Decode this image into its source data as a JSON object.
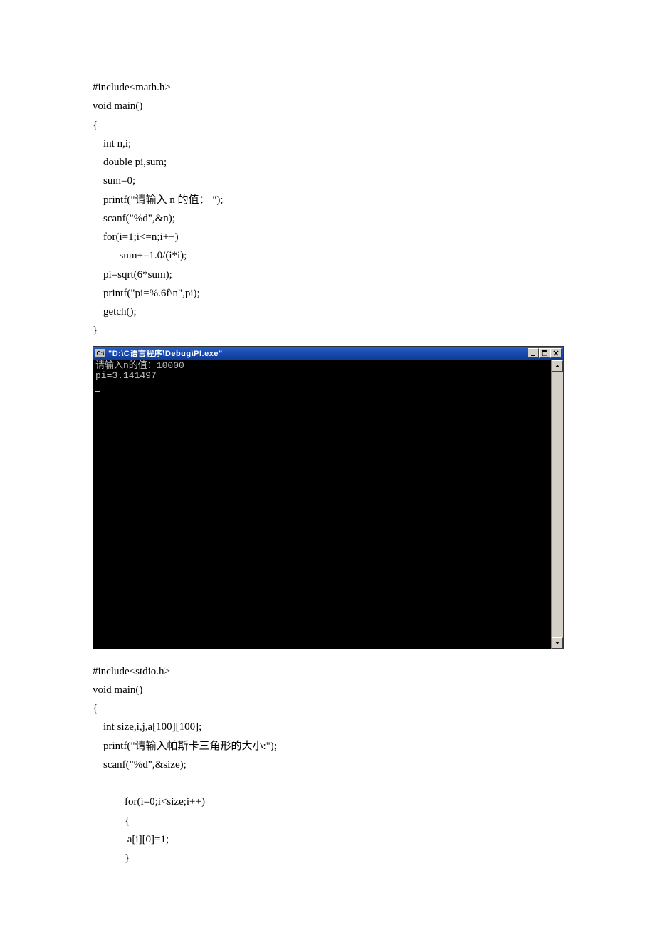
{
  "code1": {
    "line1": "#include<math.h>",
    "line2": "void main()",
    "line3": "{",
    "line4": "    int n,i;",
    "line5": "    double pi,sum;",
    "line6": "    sum=0;",
    "line7": "    printf(\"请输入 n 的值： \");",
    "line8": "    scanf(\"%d\",&n);",
    "line9": "    for(i=1;i<=n;i++)",
    "line10": "          sum+=1.0/(i*i);",
    "line11": "    pi=sqrt(6*sum);",
    "line12": "    printf(\"pi=%.6f\\n\",pi);",
    "line13": "    getch();",
    "line14": "}"
  },
  "console": {
    "title_icon": "C:\\",
    "title": "\"D:\\C语言程序\\Debug\\PI.exe\"",
    "line1": "请输入n的值：10000",
    "line2": "pi=3.141497"
  },
  "code2": {
    "line1": "#include<stdio.h>",
    "line2": "void main()",
    "line3": "{",
    "line4": "    int size,i,j,a[100][100];",
    "line5": "    printf(\"请输入帕斯卡三角形的大小:\");",
    "line6": "    scanf(\"%d\",&size);",
    "line7": "",
    "line8": "            for(i=0;i<size;i++)",
    "line9": "            {",
    "line10": "             a[i][0]=1;",
    "line11": "            }"
  }
}
